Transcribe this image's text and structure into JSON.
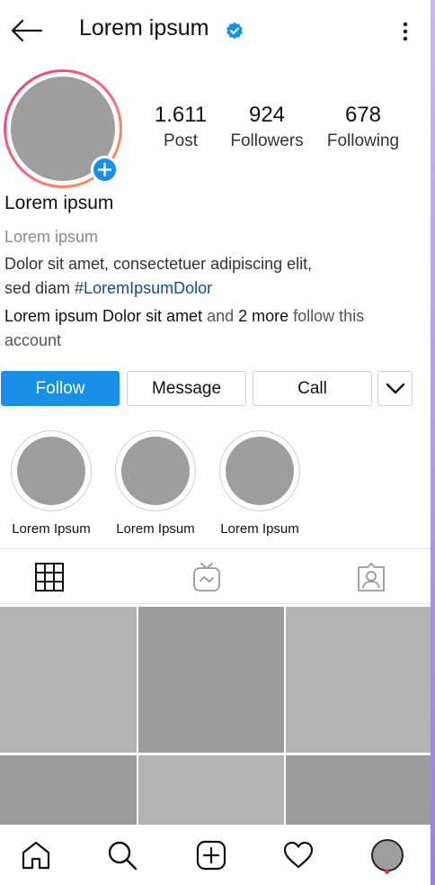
{
  "header": {
    "username": "Lorem ipsum",
    "back_icon": "arrow-left-icon",
    "verified_icon": "verified-badge-icon",
    "more_icon": "vertical-dots-icon"
  },
  "profile": {
    "stats": [
      {
        "value": "1.611",
        "label": "Post"
      },
      {
        "value": "924",
        "label": "Followers"
      },
      {
        "value": "678",
        "label": "Following"
      }
    ]
  },
  "bio": {
    "name": "Lorem ipsum",
    "category": "Lorem ipsum",
    "text_line1": "Dolor sit amet, consectetuer adipiscing elit,",
    "text_line2_prefix": "sed diam ",
    "hashtag": "#LoremIpsumDolor",
    "followed_by_names": "Lorem ipsum Dolor sit amet",
    "followed_by_and": " and ",
    "followed_by_more": "2 more",
    "followed_by_suffix": " follow this account"
  },
  "actions": {
    "follow": "Follow",
    "message": "Message",
    "call": "Call"
  },
  "highlights": [
    {
      "label": "Lorem Ipsum"
    },
    {
      "label": "Lorem Ipsum"
    },
    {
      "label": "Lorem Ipsum"
    }
  ],
  "tabs": [
    "grid-icon",
    "igtv-icon",
    "tagged-icon"
  ],
  "colors": {
    "accent": "#1a8fe8",
    "hashtag": "#1a4a8a",
    "placeholder": "#9e9e9e",
    "tile_light": "#b4b4b4",
    "tile_dark": "#9c9c9c",
    "notification_dot": "#e63946"
  },
  "bottom_nav": [
    "home-icon",
    "search-icon",
    "add-post-icon",
    "heart-icon",
    "profile-avatar"
  ]
}
